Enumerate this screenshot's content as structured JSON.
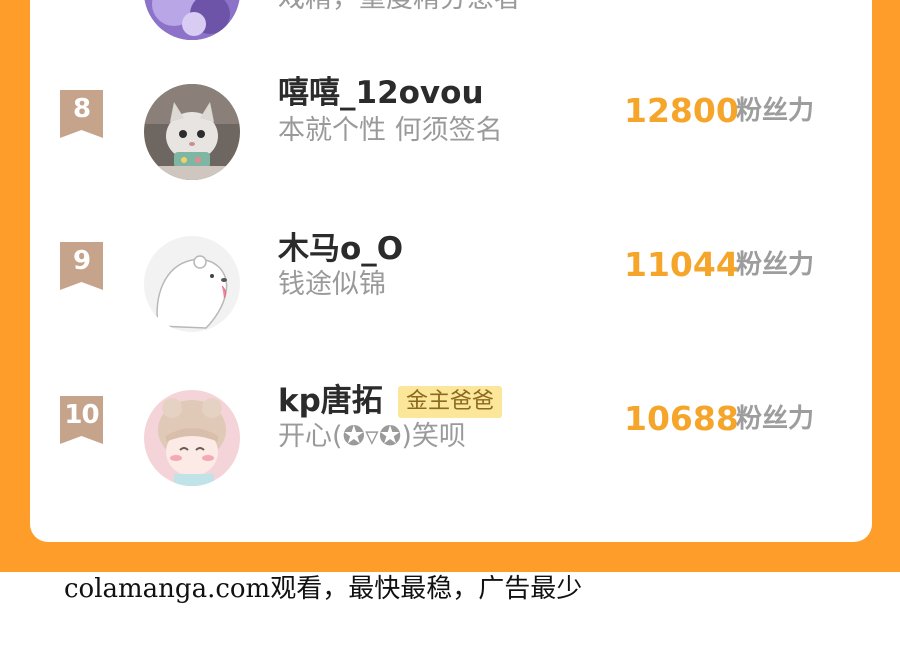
{
  "previous_entry": {
    "signature": "戏精，重度精分患者"
  },
  "leaderboard": [
    {
      "rank": "8",
      "name": "嘻嘻_12ovou",
      "signature": "本就个性 何须签名",
      "fans": "12800",
      "fans_label": "粉丝力",
      "avatar": "cat-avatar-icon"
    },
    {
      "rank": "9",
      "name": "木马o_O",
      "signature": "钱途似锦",
      "fans": "11044",
      "fans_label": "粉丝力",
      "avatar": "bear-avatar-icon"
    },
    {
      "rank": "10",
      "name": "kp唐拓",
      "tag": "金主爸爸",
      "signature": "开心(✪▿✪)笑呗",
      "fans": "10688",
      "fans_label": "粉丝力",
      "avatar": "anime-girl-avatar-icon"
    }
  ],
  "footer": {
    "text": "colamanga.com观看，最快最稳，广告最少"
  },
  "colors": {
    "page_orange": "#ff9d2a",
    "fans_number": "#f6a52b",
    "rank_badge": "#c6a48c",
    "vip_tag_bg": "#fbe69a"
  }
}
